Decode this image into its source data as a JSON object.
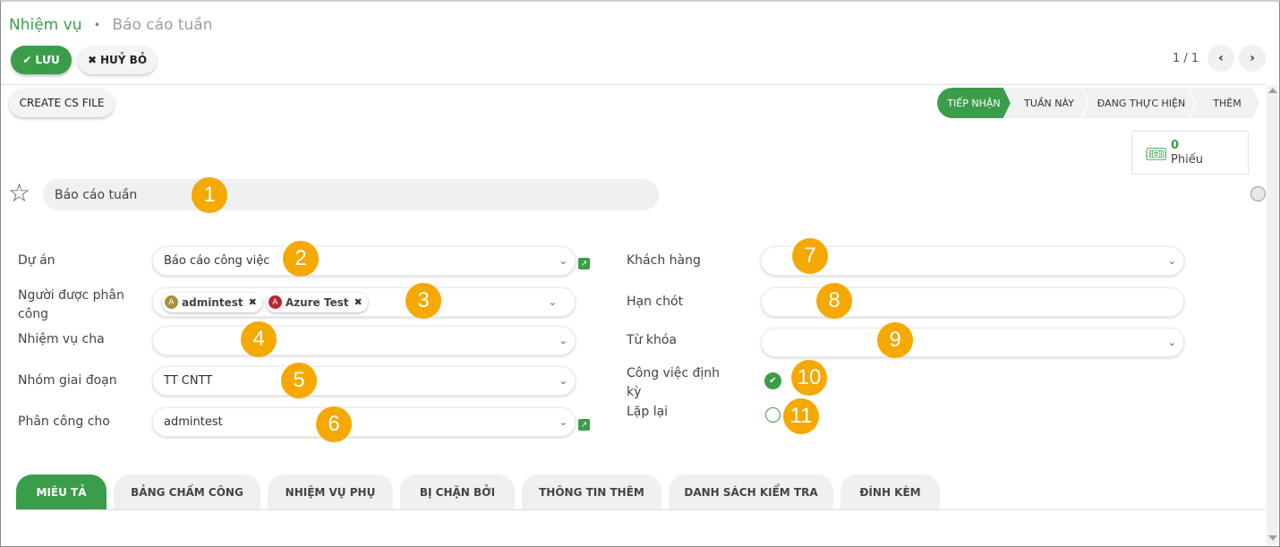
{
  "breadcrumb": {
    "parent": "Nhiệm vụ",
    "separator": "•",
    "current": "Báo cáo tuần"
  },
  "toolbar": {
    "save_label": "LƯU",
    "discard_label": "HUỶ BỎ",
    "create_cs_label": "CREATE CS FILE"
  },
  "pager": {
    "text": "1 / 1"
  },
  "stages": [
    {
      "label": "TIẾP NHẬN",
      "active": true
    },
    {
      "label": "TUẦN NÀY",
      "active": false
    },
    {
      "label": "ĐANG THỰC HIỆN",
      "active": false
    },
    {
      "label": "THÊM",
      "active": false
    }
  ],
  "ticket": {
    "count": "0",
    "label": "Phiếu"
  },
  "title": "Báo cáo tuần",
  "left_fields": {
    "project": {
      "label": "Dự án",
      "value": "Báo cáo công việc"
    },
    "assignees": {
      "label": "Người được phân công",
      "tags": [
        {
          "initial": "A",
          "name": "admintest",
          "color": "#a8913c"
        },
        {
          "initial": "A",
          "name": "Azure Test",
          "color": "#b9262f"
        }
      ]
    },
    "parent_task": {
      "label": "Nhiệm vụ cha",
      "value": ""
    },
    "stage_group": {
      "label": "Nhóm giai đoạn",
      "value": "TT CNTT"
    },
    "assigned_to": {
      "label": "Phân công cho",
      "value": "admintest"
    }
  },
  "right_fields": {
    "customer": {
      "label": "Khách hàng",
      "value": ""
    },
    "deadline": {
      "label": "Hạn chót",
      "value": ""
    },
    "tags": {
      "label": "Từ khóa",
      "value": ""
    },
    "recurring": {
      "label": "Công việc định kỳ",
      "checked": true
    },
    "repeat": {
      "label": "Lặp lại",
      "checked": false
    }
  },
  "callouts": [
    "1",
    "2",
    "3",
    "4",
    "5",
    "6",
    "7",
    "8",
    "9",
    "10",
    "11"
  ],
  "tabs": [
    {
      "label": "MIÊU TẢ",
      "active": true
    },
    {
      "label": "BẢNG CHẤM CÔNG",
      "active": false
    },
    {
      "label": "NHIỆM VỤ PHỤ",
      "active": false
    },
    {
      "label": "BỊ CHẶN BỞI",
      "active": false
    },
    {
      "label": "THÔNG TIN THÊM",
      "active": false
    },
    {
      "label": "DANH SÁCH KIỂM TRA",
      "active": false
    },
    {
      "label": "ĐÍNH KÈM",
      "active": false
    }
  ],
  "colors": {
    "accent": "#3a9d4a",
    "callout": "#f5a800"
  }
}
